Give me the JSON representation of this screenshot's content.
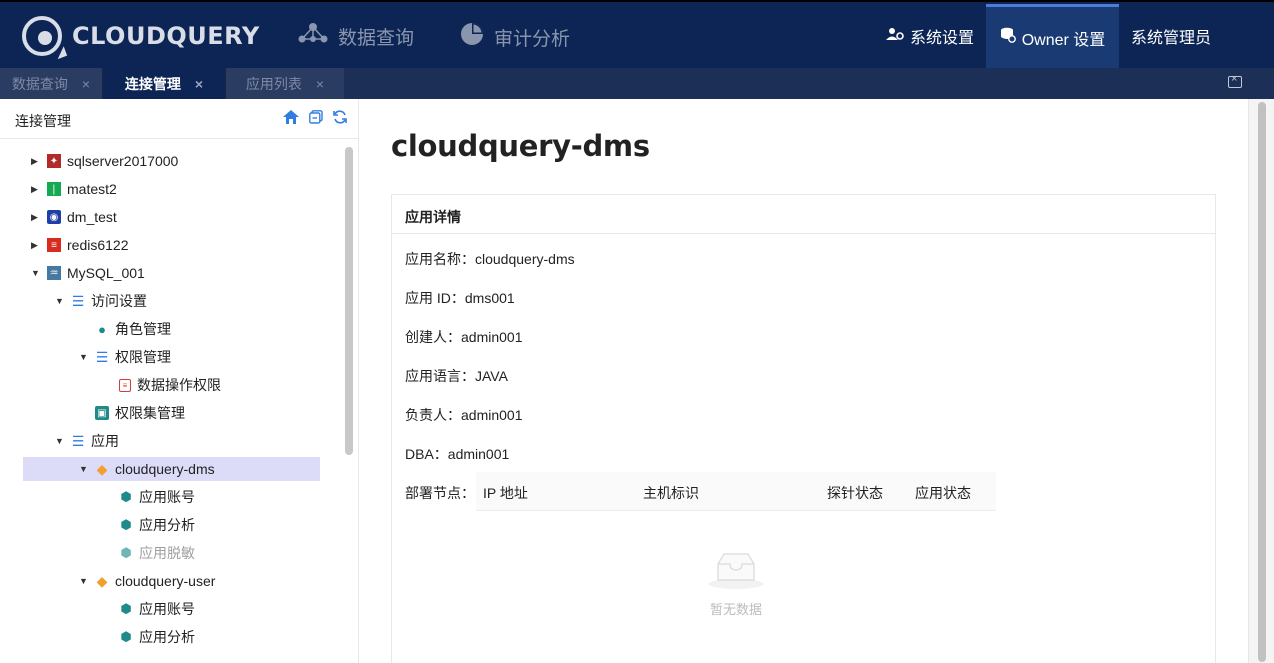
{
  "header": {
    "logo_text": "CLOUDQUERY",
    "nav": [
      {
        "label": "数据查询",
        "icon": "network-icon"
      },
      {
        "label": "审计分析",
        "icon": "pie-chart-icon"
      }
    ],
    "right_menu": [
      {
        "label": "系统设置",
        "icon": "user-settings-icon"
      },
      {
        "label": "Owner 设置",
        "icon": "database-settings-icon"
      },
      {
        "label": "系统管理员"
      }
    ]
  },
  "tabs": [
    {
      "label": "数据查询",
      "active": false
    },
    {
      "label": "连接管理",
      "active": true
    },
    {
      "label": "应用列表",
      "active": false
    }
  ],
  "left_panel": {
    "title": "连接管理",
    "tree": [
      {
        "label": "sqlserver2017000",
        "icon": "sqlserver-icon",
        "color": "#b22a2a",
        "expanded": false,
        "level": 0
      },
      {
        "label": "matest2",
        "icon": "mongodb-icon",
        "color": "#13aa52",
        "expanded": false,
        "level": 0
      },
      {
        "label": "dm_test",
        "icon": "dameng-icon",
        "color": "#1f3fa8",
        "expanded": false,
        "level": 0
      },
      {
        "label": "redis6122",
        "icon": "redis-icon",
        "color": "#d82c20",
        "expanded": false,
        "level": 0
      },
      {
        "label": "MySQL_001",
        "icon": "mysql-icon",
        "color": "#4479a1",
        "expanded": true,
        "level": 0
      },
      {
        "label": "访问设置",
        "icon": "list-icon",
        "expanded": true,
        "level": 1
      },
      {
        "label": "角色管理",
        "icon": "role-icon",
        "level": 2
      },
      {
        "label": "权限管理",
        "icon": "list-icon",
        "expanded": true,
        "level": 2
      },
      {
        "label": "数据操作权限",
        "icon": "permission-icon",
        "level": 3
      },
      {
        "label": "权限集管理",
        "icon": "permission-set-icon",
        "level": 2
      },
      {
        "label": "应用",
        "icon": "list-icon",
        "expanded": true,
        "level": 1
      },
      {
        "label": "cloudquery-dms",
        "icon": "app-cube-icon",
        "expanded": true,
        "level": 2,
        "selected": true
      },
      {
        "label": "应用账号",
        "icon": "app-account-icon",
        "level": 3
      },
      {
        "label": "应用分析",
        "icon": "app-analysis-icon",
        "level": 3
      },
      {
        "label": "应用脱敏",
        "icon": "app-mask-icon",
        "level": 3,
        "dimmed": true
      },
      {
        "label": "cloudquery-user",
        "icon": "app-cube-icon",
        "expanded": true,
        "level": 2
      },
      {
        "label": "应用账号",
        "icon": "app-account-icon",
        "level": 3
      },
      {
        "label": "应用分析",
        "icon": "app-analysis-icon",
        "level": 3
      }
    ]
  },
  "main": {
    "title": "cloudquery-dms",
    "card_title": "应用详情",
    "fields": [
      {
        "label": "应用名称：",
        "value": "cloudquery-dms"
      },
      {
        "label": "应用 ID：",
        "value": "dms001"
      },
      {
        "label": "创建人：",
        "value": "admin001"
      },
      {
        "label": "应用语言：",
        "value": "JAVA"
      },
      {
        "label": "负责人：",
        "value": "admin001"
      },
      {
        "label": "DBA：",
        "value": "admin001"
      }
    ],
    "deploy_label": "部署节点：",
    "table_headers": [
      "IP 地址",
      "主机标识",
      "探针状态",
      "应用状态"
    ],
    "empty_text": "暂无数据"
  }
}
